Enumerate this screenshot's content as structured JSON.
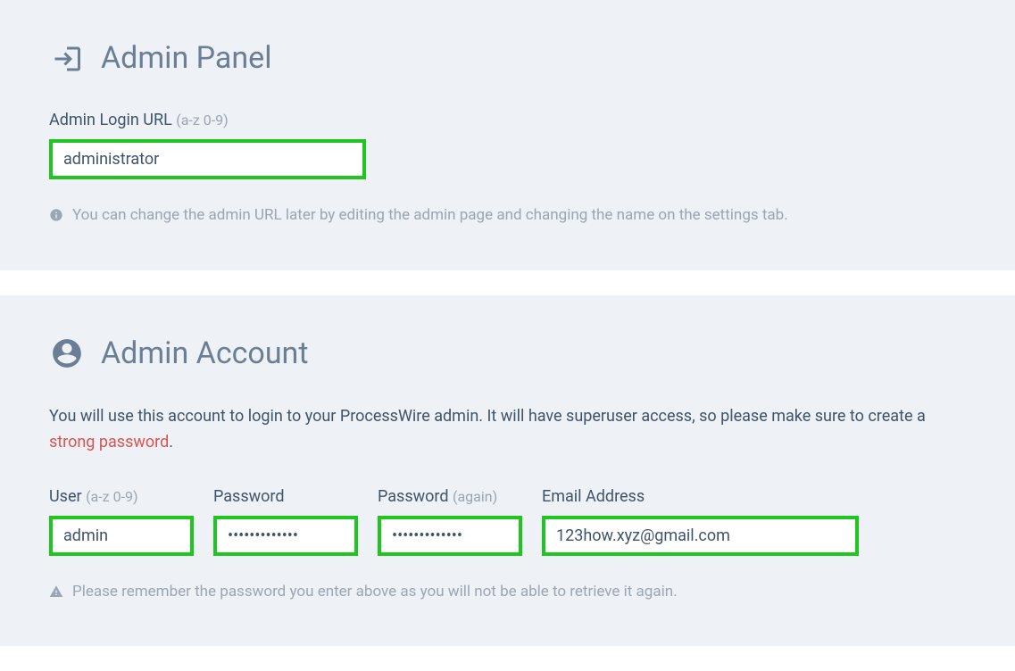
{
  "panel1": {
    "title": "Admin Panel",
    "url_label": "Admin Login URL",
    "url_hint": "(a-z 0-9)",
    "url_value": "administrator",
    "info_text": "You can change the admin URL later by editing the admin page and changing the name on the settings tab."
  },
  "panel2": {
    "title": "Admin Account",
    "intro_before": "You will use this account to login to your ProcessWire admin. It will have superuser access, so please make sure to create a ",
    "intro_link": "strong password",
    "intro_after": ".",
    "user_label": "User",
    "user_hint": "(a-z 0-9)",
    "user_value": "admin",
    "password_label": "Password",
    "password_value": "password12345",
    "password2_label": "Password",
    "password2_hint": "(again)",
    "password2_value": "password12345",
    "email_label": "Email Address",
    "email_value": "123how.xyz@gmail.com",
    "warning_text": "Please remember the password you enter above as you will not be able to retrieve it again."
  }
}
